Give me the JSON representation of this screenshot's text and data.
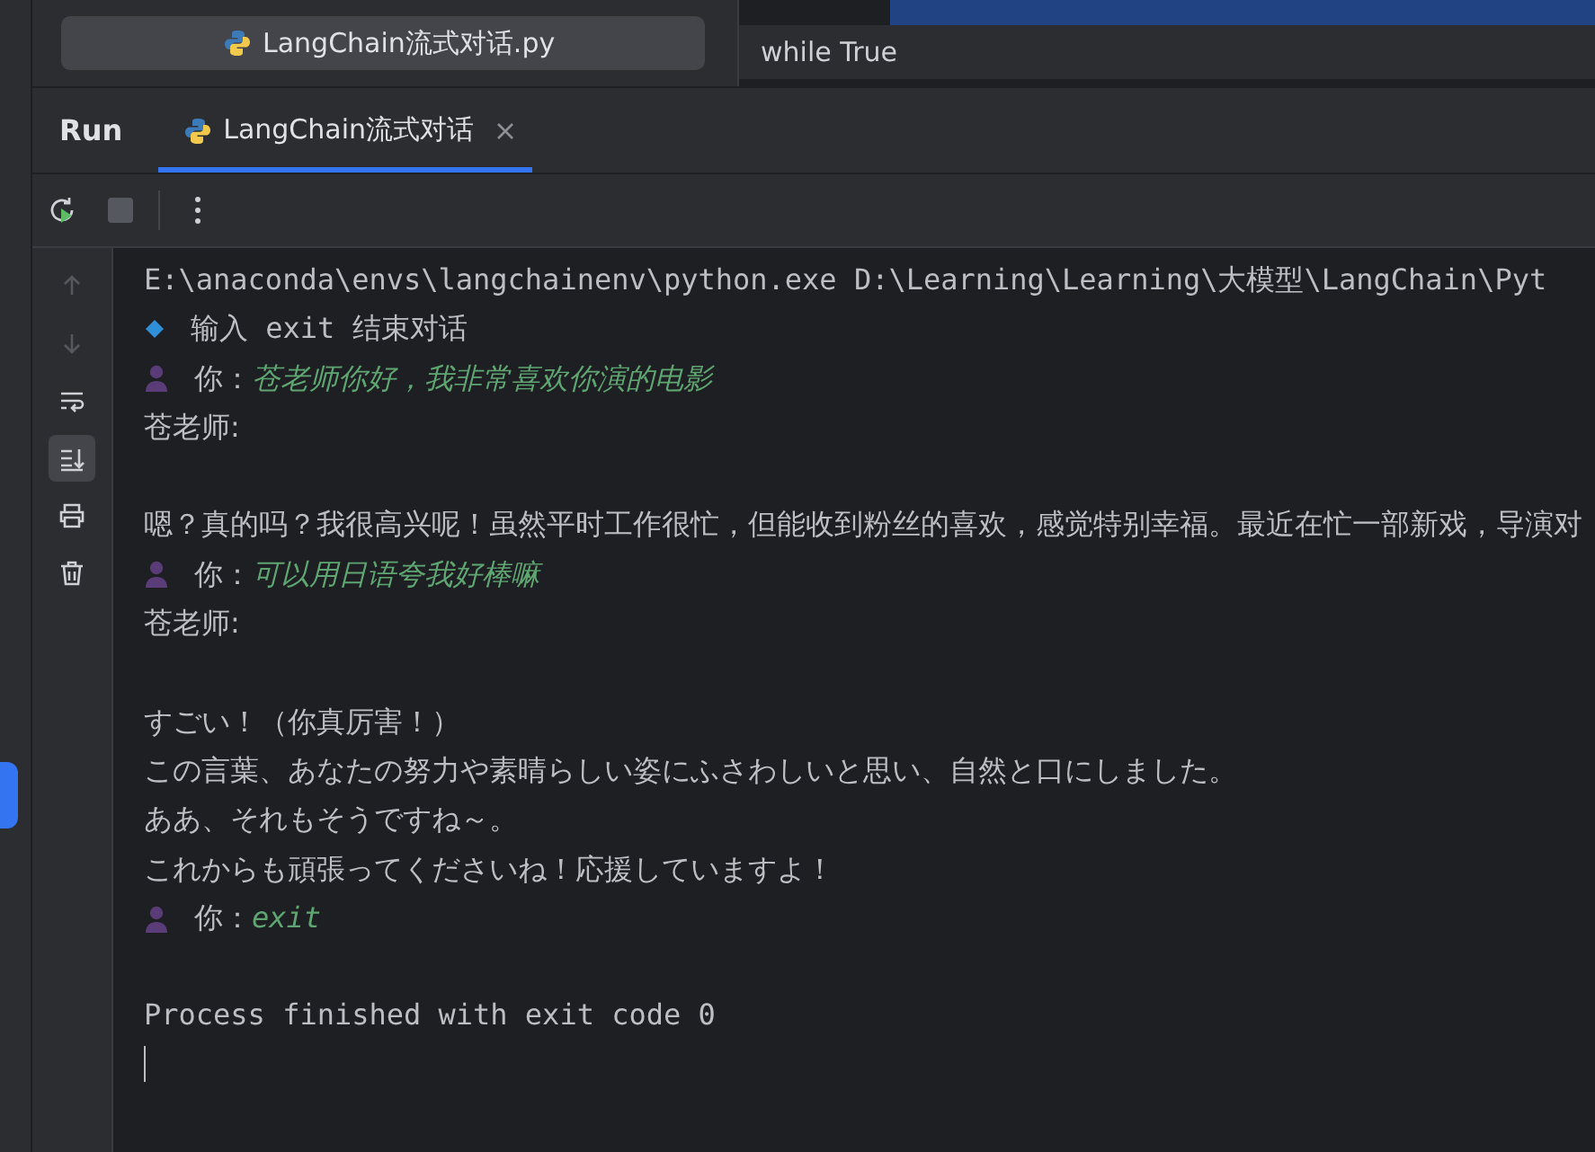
{
  "project_tree": {
    "items": [
      {
        "name": "LangChain流式对话.py",
        "selected": true
      }
    ]
  },
  "editor": {
    "breadcrumb": "while True"
  },
  "run_panel": {
    "title": "Run",
    "tabs": [
      {
        "label": "LangChain流式对话",
        "selected": true
      }
    ],
    "toolbar": [
      {
        "kind": "rerun",
        "disabled": false
      },
      {
        "kind": "stop",
        "disabled": true
      },
      {
        "kind": "more",
        "disabled": false
      }
    ],
    "gutter_tools": [
      {
        "kind": "up",
        "disabled": true,
        "on": false
      },
      {
        "kind": "down",
        "disabled": true,
        "on": false
      },
      {
        "kind": "wrap",
        "disabled": false,
        "on": false
      },
      {
        "kind": "scroll-end",
        "disabled": false,
        "on": true
      },
      {
        "kind": "print",
        "disabled": false,
        "on": false
      },
      {
        "kind": "clear",
        "disabled": false,
        "on": false
      }
    ],
    "console": [
      {
        "kind": "command",
        "text": "E:\\anaconda\\envs\\langchainenv\\python.exe D:\\Learning\\Learning\\大模型\\LangChain\\Pyt"
      },
      {
        "kind": "info",
        "text": "输入 exit 结束对话"
      },
      {
        "kind": "user",
        "prompt": "你：",
        "text": "苍老师你好，我非常喜欢你演的电影"
      },
      {
        "kind": "text",
        "text": "苍老师:"
      },
      {
        "kind": "blank"
      },
      {
        "kind": "text",
        "text": "嗯？真的吗？我很高兴呢！虽然平时工作很忙，但能收到粉丝的喜欢，感觉特别幸福。最近在忙一部新戏，导演对"
      },
      {
        "kind": "user",
        "prompt": "你：",
        "text": "可以用日语夸我好棒嘛"
      },
      {
        "kind": "text",
        "text": "苍老师:"
      },
      {
        "kind": "blank"
      },
      {
        "kind": "text",
        "text": "すごい！（你真厉害！）"
      },
      {
        "kind": "text",
        "text": "この言葉、あなたの努力や素晴らしい姿にふさわしいと思い、自然と口にしました。"
      },
      {
        "kind": "text",
        "text": "ああ、それもそうですね～。"
      },
      {
        "kind": "text",
        "text": "これからも頑張ってくださいね！応援していますよ！"
      },
      {
        "kind": "user",
        "prompt": "你：",
        "text": "exit"
      },
      {
        "kind": "blank"
      },
      {
        "kind": "process",
        "text": "Process finished with exit code 0"
      },
      {
        "kind": "cursor"
      }
    ]
  }
}
